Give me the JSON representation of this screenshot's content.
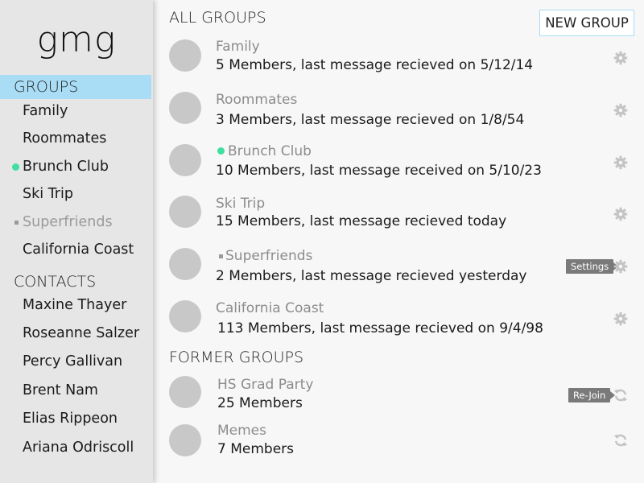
{
  "app": {
    "logo": "gmg"
  },
  "sidebar": {
    "groups_header": "GROUPS",
    "groups": [
      {
        "label": "Family"
      },
      {
        "label": "Roommates"
      },
      {
        "label": "Brunch Club",
        "status": "active-dot"
      },
      {
        "label": "Ski Trip"
      },
      {
        "label": "Superfriends",
        "status": "muted-square"
      },
      {
        "label": "California Coast"
      }
    ],
    "contacts_header": "CONTACTS",
    "contacts": [
      {
        "label": "Maxine Thayer"
      },
      {
        "label": "Roseanne Salzer"
      },
      {
        "label": "Percy Gallivan"
      },
      {
        "label": "Brent Nam"
      },
      {
        "label": "Elias Rippeon"
      },
      {
        "label": "Ariana Odriscoll"
      }
    ]
  },
  "main": {
    "all_groups_header": "ALL GROUPS",
    "new_group_label": "NEW GROUP",
    "groups": [
      {
        "name": "Family",
        "details": "5 Members, last message recieved on 5/12/14",
        "action_icon": "gear-icon"
      },
      {
        "name": "Roommates",
        "details": "3 Members, last message recieved on 1/8/54",
        "action_icon": "gear-icon"
      },
      {
        "name": "Brunch Club",
        "details": "10 Members, last message received on 5/10/23",
        "action_icon": "gear-icon",
        "status": "active-dot"
      },
      {
        "name": "Ski Trip",
        "details": "15 Members, last message recieved today",
        "action_icon": "gear-icon"
      },
      {
        "name": "Superfriends",
        "details": "2 Members, last message recieved yesterday",
        "action_icon": "gear-icon",
        "status": "muted-square",
        "tooltip": "Settings"
      },
      {
        "name": "California Coast",
        "details": "113 Members, last message recieved on 9/4/98",
        "action_icon": "gear-icon"
      }
    ],
    "former_groups_header": "FORMER GROUPS",
    "former_groups": [
      {
        "name": "HS Grad Party",
        "details": "25 Members",
        "action_icon": "refresh-icon",
        "tooltip": "Re-Join"
      },
      {
        "name": "Memes",
        "details": "7 Members",
        "action_icon": "refresh-icon"
      }
    ]
  },
  "colors": {
    "accent": "#a9ddf6",
    "active_dot": "#3de0a0",
    "sidebar_bg": "#e6e6e6",
    "avatar": "#c8c8c8",
    "icon": "#c4c4c4",
    "tooltip_bg": "#7a7a7a"
  }
}
